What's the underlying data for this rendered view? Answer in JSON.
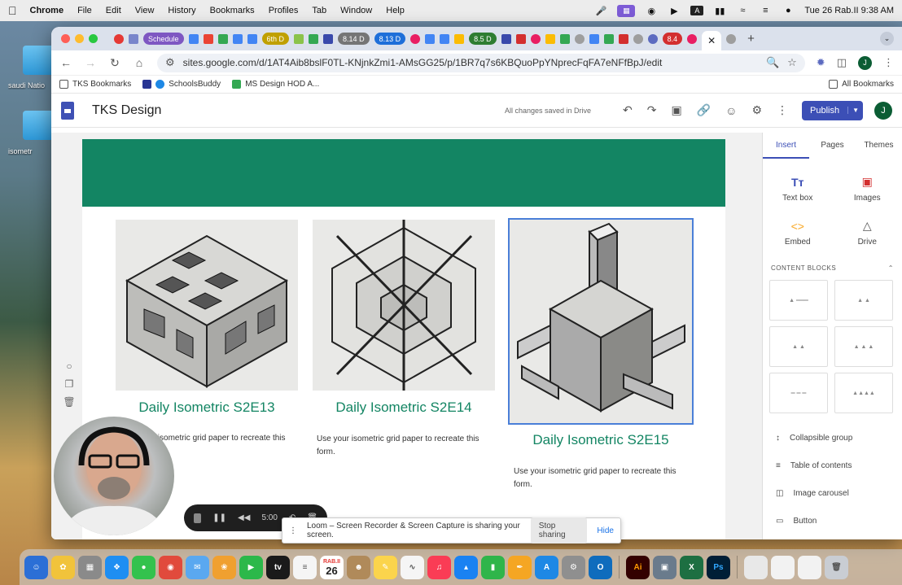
{
  "menubar": {
    "app": "Chrome",
    "menus": [
      "File",
      "Edit",
      "View",
      "History",
      "Bookmarks",
      "Profiles",
      "Tab",
      "Window",
      "Help"
    ],
    "clock": "Tue 26 Rab.II  9:38 AM"
  },
  "desktop": {
    "label1": "saudi Natio",
    "label2": "isometr"
  },
  "tabs": {
    "schedule": "Schedule",
    "day6": "6th D",
    "d814": "8.14 D",
    "d813": "8.13 D",
    "d85": "8.5 D",
    "d84": "8.4"
  },
  "address": {
    "url": "sites.google.com/d/1AT4Aib8bslF0TL-KNjnkZmi1-AMsGG25/p/1BR7q7s6KBQuoPpYNprecFqFA7eNFfBpJ/edit"
  },
  "bookmarks": {
    "items": [
      "TKS Bookmarks",
      "SchoolsBuddy",
      "MS Design HOD A..."
    ],
    "all": "All Bookmarks"
  },
  "sites": {
    "title": "TKS Design",
    "saved": "All changes saved in Drive",
    "publish": "Publish",
    "user_initial": "J"
  },
  "cards": [
    {
      "title": "Daily Isometric S2E13",
      "desc": "Use your isometric grid paper to recreate this"
    },
    {
      "title": "Daily Isometric S2E14",
      "desc": "Use your isometric grid paper to recreate this form."
    },
    {
      "title": "Daily Isometric S2E15",
      "desc": "Use your isometric grid paper to recreate this form."
    }
  ],
  "panel": {
    "tabs": [
      "Insert",
      "Pages",
      "Themes"
    ],
    "insert_items": [
      "Text box",
      "Images",
      "Embed",
      "Drive"
    ],
    "content_blocks": "CONTENT BLOCKS",
    "list": [
      "Collapsible group",
      "Table of contents",
      "Image carousel",
      "Button"
    ]
  },
  "loom": {
    "timer": "5:00",
    "share_msg": "Loom – Screen Recorder & Screen Capture is sharing your screen.",
    "stop": "Stop sharing",
    "hide": "Hide"
  },
  "dock": {
    "calendar_month": "RAB.II",
    "calendar_day": "26"
  },
  "colors": {
    "banner_green": "#138563",
    "publish_blue": "#3c4fb6"
  }
}
